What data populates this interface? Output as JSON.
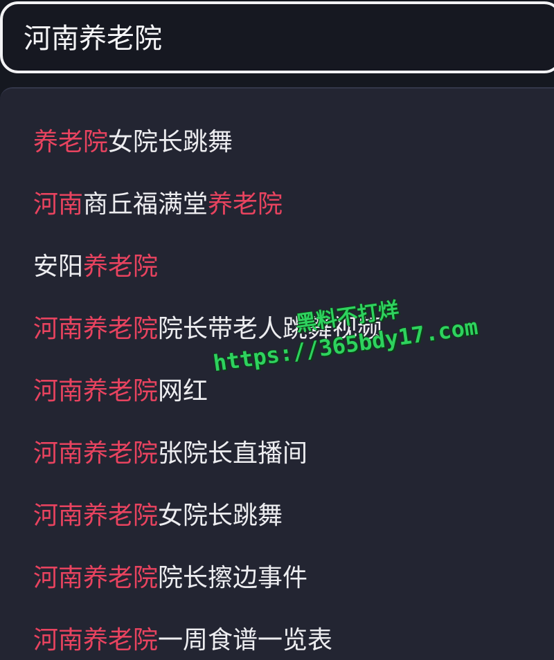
{
  "search": {
    "value": "河南养老院"
  },
  "suggestions": [
    {
      "highlight": "养老院",
      "rest": "女院长跳舞"
    },
    {
      "highlight": "河南",
      "rest": "商丘福满堂",
      "highlight2": "养老院"
    },
    {
      "prefix": "安阳",
      "highlight": "养老院"
    },
    {
      "highlight": "河南养老院",
      "rest": "院长带老人跳舞视频"
    },
    {
      "highlight": "河南养老院",
      "rest": "网红"
    },
    {
      "highlight": "河南养老院",
      "rest": "张院长直播间"
    },
    {
      "highlight": "河南养老院",
      "rest": "女院长跳舞"
    },
    {
      "highlight": "河南养老院",
      "rest": "院长擦边事件"
    },
    {
      "highlight": "河南养老院",
      "rest": "一周食谱一览表"
    }
  ],
  "watermark": {
    "line1": "黑料不打烊",
    "line2": "https://365bdy17.com"
  },
  "colors": {
    "background": "#151820",
    "panel": "#232532",
    "highlight": "#e8435f",
    "text": "#ededf0",
    "watermark": "#2ed25e"
  }
}
